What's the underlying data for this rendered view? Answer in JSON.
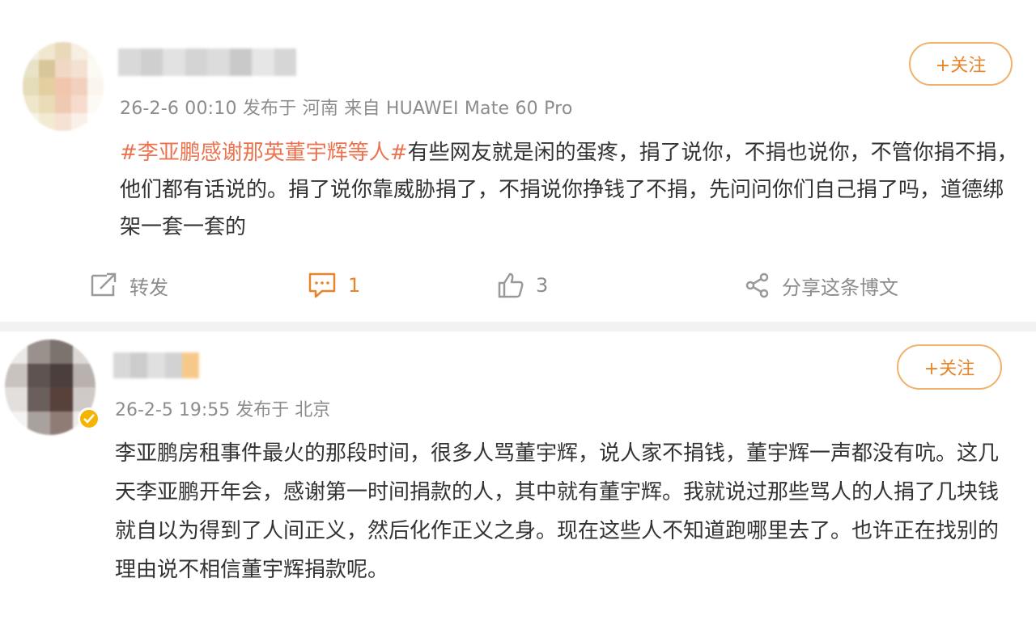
{
  "posts": [
    {
      "meta": "26-2-6 00:10 发布于 河南 来自 HUAWEI Mate 60 Pro",
      "follow_label": "+关注",
      "hashtag": "#李亚鹏感谢那英董宇辉等人#",
      "text": "有些网友就是闲的蛋疼，捐了说你，不捐也说你，不管你捐不捐，他们都有话说的。捐了说你靠威胁捐了，不捐说你挣钱了不捐，先问问你们自己捐了吗，道德绑架一套一套的",
      "actions": {
        "repost_label": "转发",
        "comment_count": "1",
        "like_count": "3",
        "share_label": "分享这条博文"
      }
    },
    {
      "meta": "26-2-5 19:55 发布于 北京",
      "follow_label": "+关注",
      "text": "李亚鹏房租事件最火的那段时间，很多人骂董宇辉，说人家不捐钱，董宇辉一声都没有吭。这几天李亚鹏开年会，感谢第一时间捐款的人，其中就有董宇辉。我就说过那些骂人的人捐了几块钱就自以为得到了人间正义，然后化作正义之身。现在这些人不知道跑哪里去了。也许正在找别的理由说不相信董宇辉捐款呢。"
    }
  ],
  "colors": {
    "accent": "#e8842a",
    "hashtag": "#eb7350",
    "meta": "#8c8c8c",
    "verified": "#f5b400"
  },
  "icons": [
    "repost-icon",
    "comment-icon",
    "like-icon",
    "share-icon",
    "verified-badge-icon"
  ]
}
